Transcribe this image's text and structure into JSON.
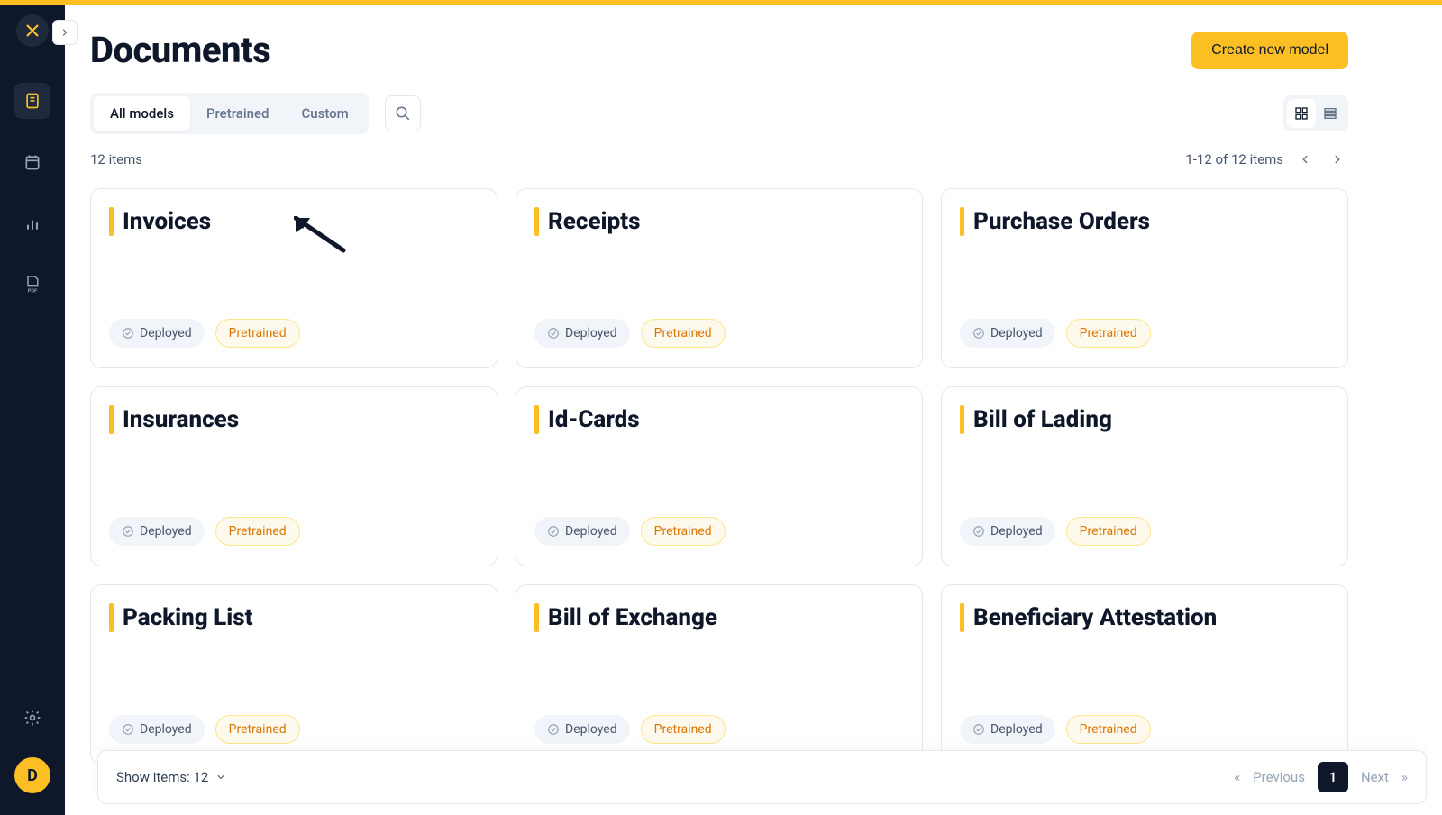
{
  "page": {
    "title": "Documents"
  },
  "header": {
    "create_button": "Create new model"
  },
  "tabs": {
    "all": "All models",
    "pretrained": "Pretrained",
    "custom": "Custom"
  },
  "list_meta": {
    "count_label": "12 items",
    "range_label": "1-12 of 12 items"
  },
  "badges": {
    "deployed": "Deployed",
    "pretrained": "Pretrained"
  },
  "cards": [
    {
      "title": "Invoices",
      "deployed": true,
      "pretrained": true
    },
    {
      "title": "Receipts",
      "deployed": true,
      "pretrained": true
    },
    {
      "title": "Purchase Orders",
      "deployed": true,
      "pretrained": true
    },
    {
      "title": "Insurances",
      "deployed": true,
      "pretrained": true
    },
    {
      "title": "Id-Cards",
      "deployed": true,
      "pretrained": true
    },
    {
      "title": "Bill of Lading",
      "deployed": true,
      "pretrained": true
    },
    {
      "title": "Packing List",
      "deployed": true,
      "pretrained": true
    },
    {
      "title": "Bill of Exchange",
      "deployed": true,
      "pretrained": true
    },
    {
      "title": "Beneficiary Attestation",
      "deployed": true,
      "pretrained": true
    }
  ],
  "footer": {
    "show_items_label": "Show items: 12",
    "prev": "Previous",
    "next": "Next",
    "page": "1",
    "first": "«",
    "last": "»"
  },
  "sidebar": {
    "avatar_initial": "D"
  }
}
